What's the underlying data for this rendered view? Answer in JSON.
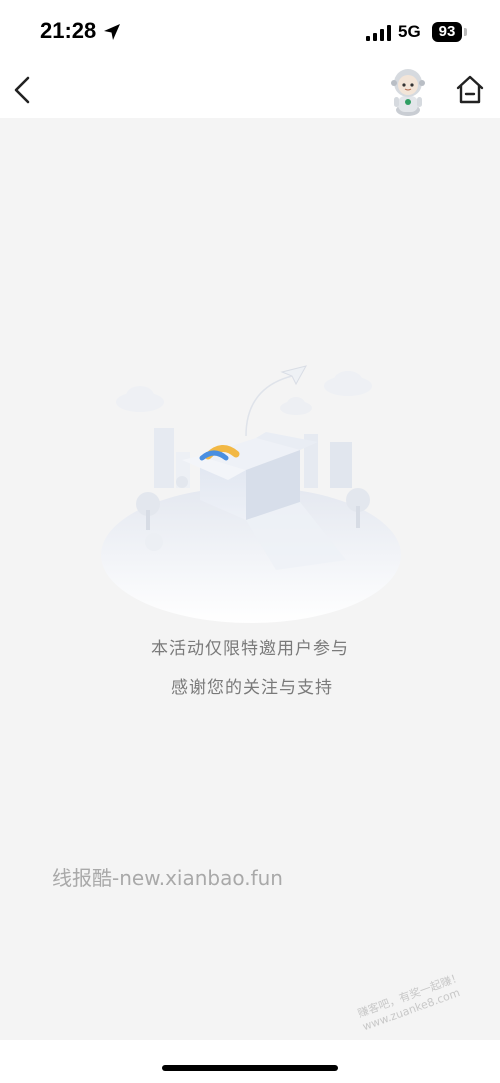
{
  "status_bar": {
    "time": "21:28",
    "network": "5G",
    "battery": "93",
    "icons": [
      "location-arrow-icon",
      "signal-bars-icon",
      "battery-icon"
    ]
  },
  "nav_bar": {
    "icons": [
      "back-arrow-icon",
      "mascot-avatar",
      "home-icon"
    ]
  },
  "main": {
    "illustration": "empty-state-box-illustration",
    "message_line1": "本活动仅限特邀用户参与",
    "message_line2": "感谢您的关注与支持"
  },
  "watermark": {
    "text": "线报酷-new.xianbao.fun",
    "corner_line1": "赚客吧，有奖一起赚！",
    "corner_line2": "www.zuanke8.com"
  },
  "colors": {
    "page_background": "#f4f4f4",
    "bar_background": "#ffffff",
    "message_text": "#7a7a7a",
    "watermark_text": "#a9a9a9"
  }
}
